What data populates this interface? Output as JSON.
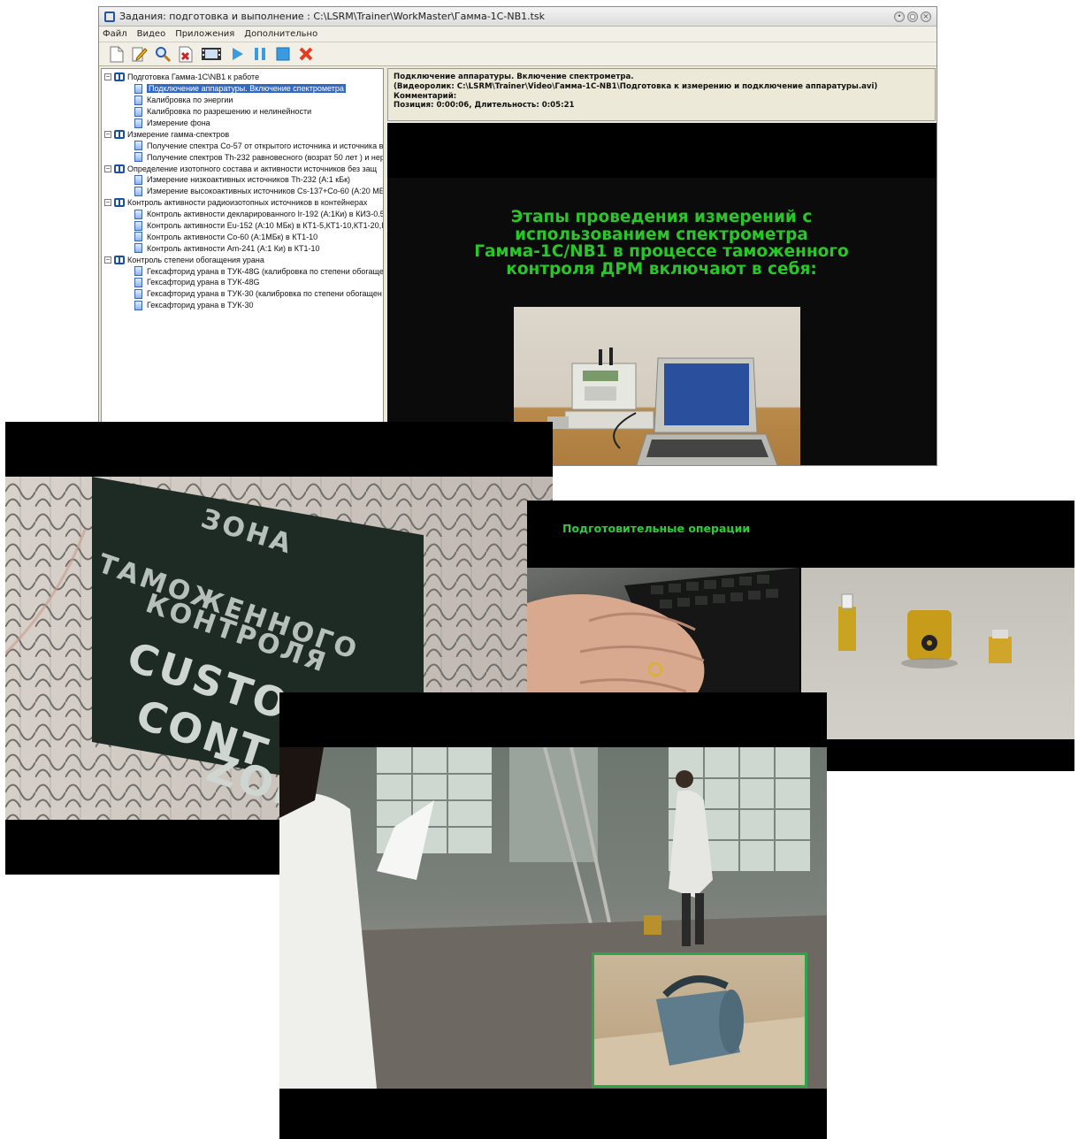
{
  "window": {
    "title": "Задания: подготовка и выполнение  : C:\\LSRM\\Trainer\\WorkMaster\\Гамма-1С-NB1.tsk",
    "menu": [
      "Файл",
      "Видео",
      "Приложения",
      "Дополнительно"
    ],
    "toolbar": [
      "new-icon",
      "edit-icon",
      "search-icon",
      "delete-doc-icon",
      "film-icon",
      "play-icon",
      "pause-icon",
      "stop-icon",
      "close-red-icon"
    ]
  },
  "tree": [
    {
      "type": "group",
      "label": "Подготовка Гамма-1С\\NB1 к работе"
    },
    {
      "type": "leaf",
      "label": "Подключение аппаратуры. Включение спектрометра",
      "selected": true
    },
    {
      "type": "leaf",
      "label": "Калибровка по энергии"
    },
    {
      "type": "leaf",
      "label": "Калибровка по разрешению и нелинейности"
    },
    {
      "type": "leaf",
      "label": "Измерение фона"
    },
    {
      "type": "group",
      "label": "Измерение гамма-спектров"
    },
    {
      "type": "leaf",
      "label": "Получение спектра Co-57 от открытого источника и источника в"
    },
    {
      "type": "leaf",
      "label": "Получение спектров Th-232  равновесного (возрат 50 лет ) и нер"
    },
    {
      "type": "group",
      "label": "Определение изотопного состава и активности источников без защ"
    },
    {
      "type": "leaf",
      "label": "Измерение низкоактивных источников Th-232 (A:1 кБк)"
    },
    {
      "type": "leaf",
      "label": "Измерение высокоактивных источников  Cs-137+Co-60 (A:20 МБ"
    },
    {
      "type": "group",
      "label": "Контроль активности радиоизотопных источников в контейнерах"
    },
    {
      "type": "leaf",
      "label": "Контроль активности декларированного Ir-192 (A:1Ки) в КИЗ-0.5"
    },
    {
      "type": "leaf",
      "label": "Контроль активности Eu-152 (A:10 МБк)  в КТ1-5,КТ1-10,КТ1-20,I"
    },
    {
      "type": "leaf",
      "label": "Контроль активности Co-60 (A:1МБк) в КТ1-10"
    },
    {
      "type": "leaf",
      "label": "Контроль активности Am-241 (A:1 Ки) в КТ1-10"
    },
    {
      "type": "group",
      "label": "Контроль степени обогащения урана"
    },
    {
      "type": "leaf",
      "label": "Гексафторид урана в ТУК-48G (калибровка по степени обогаще"
    },
    {
      "type": "leaf",
      "label": "Гексафторид урана в ТУК-48G"
    },
    {
      "type": "leaf",
      "label": "Гексафторид урана в ТУК-30 (калибровка по степени обогащен"
    },
    {
      "type": "leaf",
      "label": "Гексафторид урана в ТУК-30"
    }
  ],
  "info": {
    "line1": "Подключение аппаратуры. Включение спектрометра.",
    "line2": "(Видеоролик: C:\\LSRM\\Trainer\\Video\\Гамма-1С-NB1\\Подготовка к измерению и подключение аппаратуры.avi)",
    "line3": "Комментарий:",
    "line4": "Позиция: 0:00:06, Длительность: 0:05:21"
  },
  "video": {
    "title_lines": [
      "Этапы проведения измерений с",
      "использованием   спектрометра",
      "Гамма-1С/NB1 в процессе таможенного",
      "контроля ДРМ включают в себя:"
    ]
  },
  "customs_sign": {
    "ru_lines": [
      "ЗОНА",
      "ТАМОЖЕННОГО",
      "КОНТРОЛЯ"
    ],
    "en_lines": [
      "CUSTO",
      "CONT",
      "ZON"
    ]
  },
  "prep": {
    "caption": "Подготовительные операции"
  }
}
